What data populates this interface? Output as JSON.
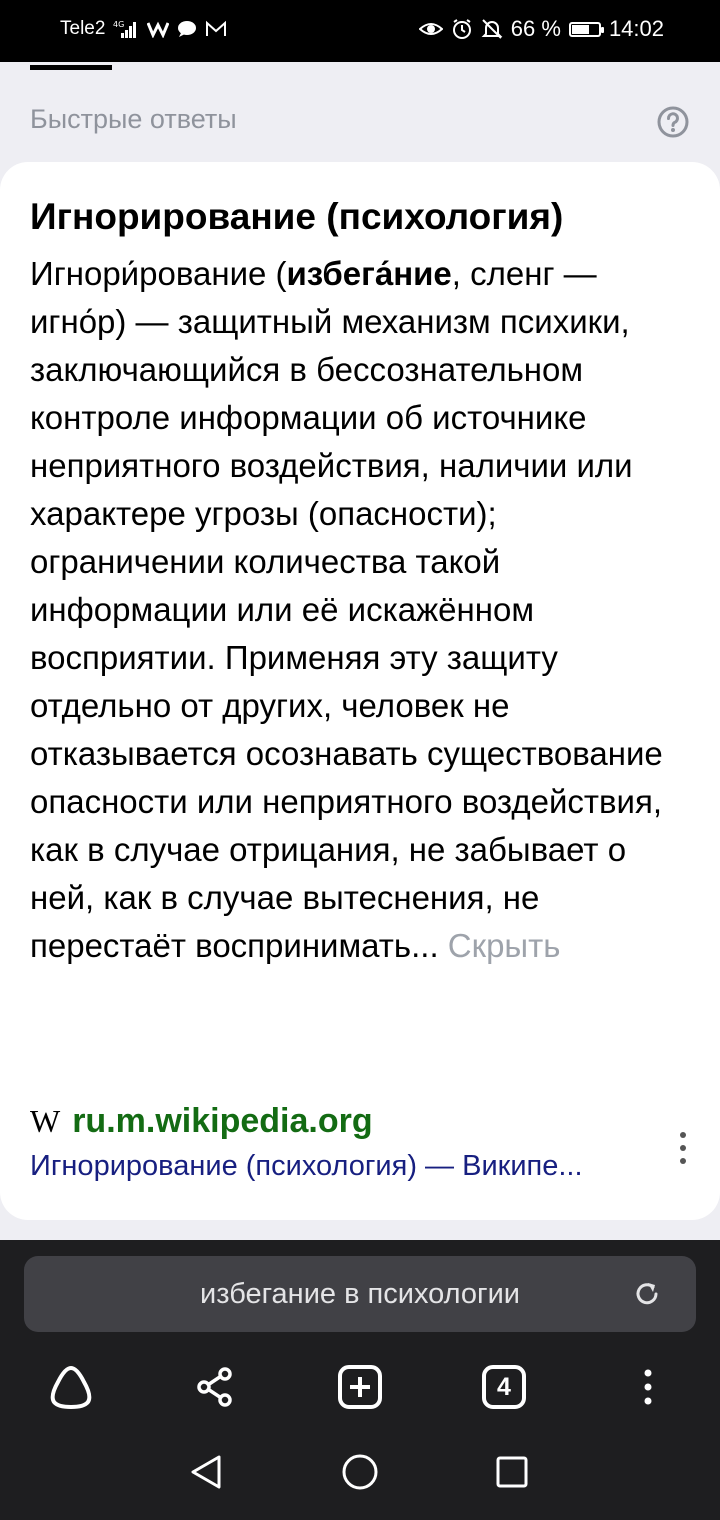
{
  "status_bar": {
    "carrier": "Tele2",
    "network": "4G",
    "battery_percent": "66 %",
    "battery_level": 0.66,
    "time": "14:02"
  },
  "section": {
    "title": "Быстрые ответы"
  },
  "answer": {
    "title": "Игнорирование (психология)",
    "body_intro": "Игнори́рование (",
    "body_bold": "избега́ние",
    "body_rest": ", сленг — игно́р) — защитный механизм психики, заключающийся в бессознательном контроле информации об источнике неприятного воздействия, наличии или характере угрозы (опасности); ограничении количества такой информации или её искажённом восприятии. Применяя эту защиту отдельно от других, человек не отказывается осознавать существование опасности или неприятного воздействия, как в случае отрицания, не забывает о ней, как в случае вытеснения, не перестаёт воспринимать...",
    "hide_label": "Скрыть",
    "source_mark": "W",
    "source_domain": "ru.m.wikipedia.org",
    "source_title": "Игнорирование (психология) — Википе..."
  },
  "browser": {
    "url_text": "избегание в психологии",
    "tab_count": "4"
  },
  "icons": {
    "help": "help-circle-icon",
    "more": "more-vert-icon",
    "reload": "reload-icon",
    "home": "alice-icon",
    "share": "share-icon",
    "new_tab": "new-tab-icon",
    "tabs": "tabs-icon",
    "menu": "menu-icon"
  }
}
